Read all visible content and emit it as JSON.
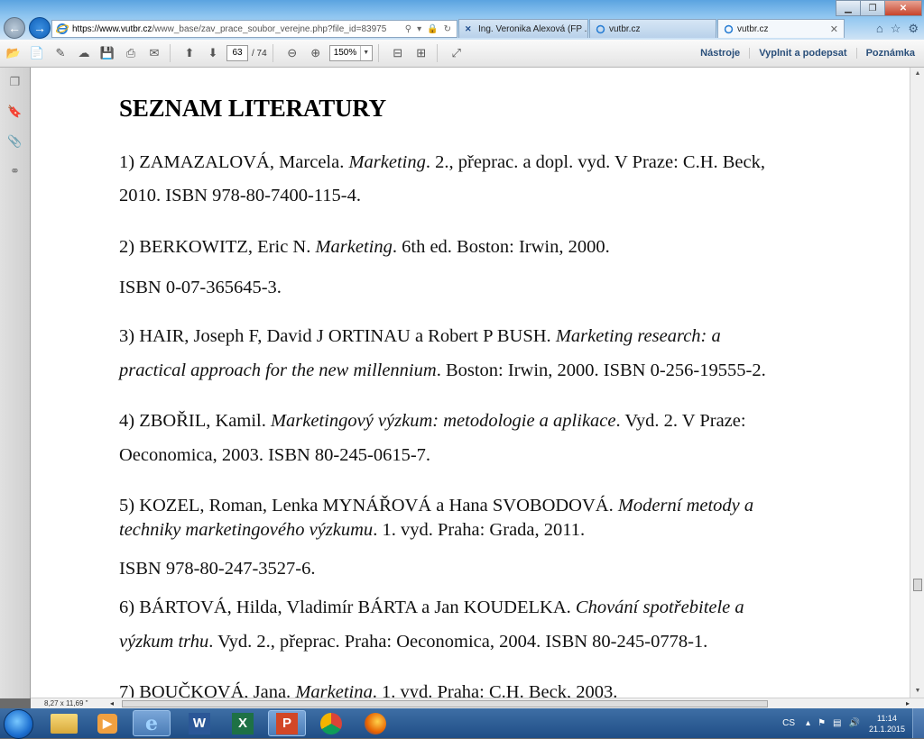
{
  "browser": {
    "address_host": "https://www.vutbr.cz",
    "address_path": "/www_base/zav_prace_soubor_verejne.php?file_id=83975",
    "tabs": [
      {
        "label": "Ing. Veronika Alexová (FP ..."
      },
      {
        "label": "vutbr.cz"
      },
      {
        "label": "vutbr.cz"
      }
    ]
  },
  "pdf_toolbar": {
    "current_page": "63",
    "total_pages": "/ 74",
    "zoom": "150%",
    "tools_label": "Nástroje",
    "sign_label": "Vyplnit a podepsat",
    "comment_label": "Poznámka"
  },
  "document": {
    "title": "SEZNAM LITERATURY",
    "refs": [
      {
        "lines": [
          {
            "a": "1) ZAMAZALOVÁ, Marcela. ",
            "i": "Marketing",
            "b": ". 2., přeprac. a dopl. vyd. V Praze: C.H. Beck,"
          },
          {
            "a": "2010. ISBN 978-80-7400-115-4.",
            "i": "",
            "b": ""
          }
        ]
      },
      {
        "lines": [
          {
            "a": "2) BERKOWITZ, Eric N. ",
            "i": "Marketing",
            "b": ". 6th ed. Boston: Irwin, 2000."
          },
          {
            "a": "ISBN 0-07-365645-3.",
            "i": "",
            "b": ""
          }
        ]
      },
      {
        "lines": [
          {
            "a": "3) HAIR, Joseph F, David J ORTINAU a Robert P BUSH. ",
            "i": "Marketing research: a",
            "b": ""
          },
          {
            "a": "",
            "i": "practical approach for the new millennium",
            "b": ". Boston: Irwin, 2000. ISBN 0-256-19555-2."
          }
        ]
      },
      {
        "lines": [
          {
            "a": "4) ZBOŘIL, Kamil. ",
            "i": "Marketingový výzkum: metodologie a aplikace",
            "b": ". Vyd. 2. V Praze:"
          },
          {
            "a": "Oeconomica, 2003. ISBN 80-245-0615-7.",
            "i": "",
            "b": ""
          }
        ]
      },
      {
        "lines": [
          {
            "a": "5) KOZEL, Roman, Lenka MYNÁŘOVÁ a Hana SVOBODOVÁ. ",
            "i": "Moderní metody a",
            "b": ""
          },
          {
            "a": "",
            "i": "techniky marketingového výzkumu",
            "b": ". 1. vyd. Praha: Grada, 2011."
          },
          {
            "a": "ISBN 978-80-247-3527-6.",
            "i": "",
            "b": ""
          }
        ]
      },
      {
        "lines": [
          {
            "a": "6) BÁRTOVÁ, Hilda, Vladimír BÁRTA a Jan KOUDELKA. ",
            "i": "Chování spotřebitele a",
            "b": ""
          },
          {
            "a": "",
            "i": "výzkum trhu",
            "b": ". Vyd. 2., přeprac. Praha: Oeconomica, 2004. ISBN 80-245-0778-1."
          }
        ]
      },
      {
        "lines": [
          {
            "a": "7) BOUČKOVÁ, Jana. ",
            "i": "Marketing",
            "b": ". 1. vyd. Praha: C.H. Beck, 2003."
          }
        ]
      }
    ]
  },
  "status": {
    "page_size": "8,27 x 11,69 \""
  },
  "taskbar": {
    "language": "CS",
    "time": "11:14",
    "date": "21.1.2015"
  },
  "colors": {
    "accent": "#1f4e86",
    "link": "#2a4f7a"
  }
}
